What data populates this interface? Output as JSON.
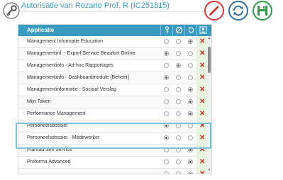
{
  "header": {
    "title": "Autorisatie van Rozario Prof. R (IC251815)",
    "icons": {
      "key": "key-icon",
      "edit": "pencil-icon",
      "sync": "sync-icon",
      "save": "save-icon"
    },
    "colors": {
      "title": "#3a9bc0",
      "edit": "#d63b3b",
      "sync": "#2d6fa8",
      "save": "#2e9a4a"
    }
  },
  "table": {
    "header": {
      "label": "Applicatie",
      "column_icons": [
        "key-icon",
        "blocked-icon",
        "refresh-icon",
        "user-icon"
      ],
      "color": "#3a9bc0"
    },
    "rows": [
      {
        "name": "Management Informatie Education",
        "selected": 3
      },
      {
        "name": "Managementinf. - Export Service Beaufort Online",
        "selected": 1
      },
      {
        "name": "Managementinfo - Ad-hoc Rapportages",
        "selected": 2
      },
      {
        "name": "Managementinfo - Dashboardmodule [Beheer]",
        "selected": 1
      },
      {
        "name": "Managementinformatie - Sociaal Verslag",
        "selected": 3
      },
      {
        "name": "Mijn Taken",
        "selected": 3
      },
      {
        "name": "Performance Management",
        "selected": 3
      },
      {
        "name": "Personeelsdossier",
        "selected": 1
      },
      {
        "name": "Personeelsdossier - Medewerker",
        "selected": 1
      },
      {
        "name": "Planrad Self Service",
        "selected": 3
      },
      {
        "name": "Proforma Advanced",
        "selected": 3
      },
      {
        "name": "",
        "selected": 3
      }
    ],
    "remove_symbol": "✕",
    "highlighted_rows": [
      "Personeelsdossier",
      "Personeelsdossier - Medewerker"
    ]
  }
}
